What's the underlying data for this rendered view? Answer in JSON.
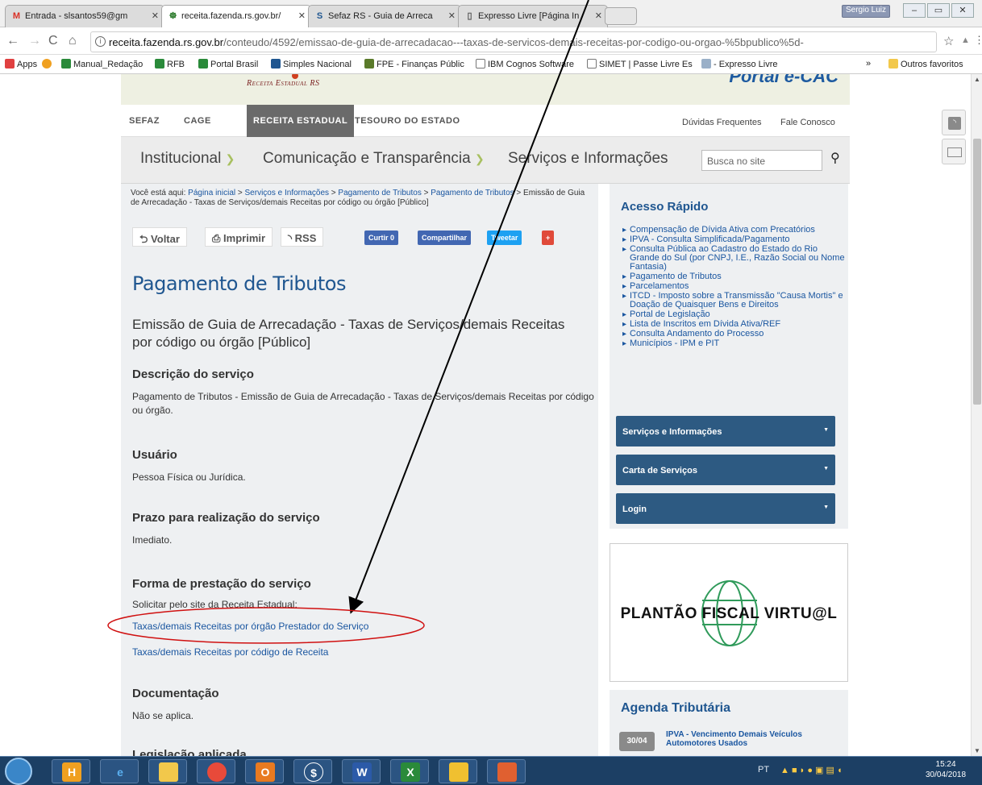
{
  "tabs": [
    {
      "label": "Entrada - slsantos59@gm",
      "icon": "M",
      "icon_color": "#d93025",
      "active": false
    },
    {
      "label": "receita.fazenda.rs.gov.br/",
      "icon": "☸",
      "icon_color": "#2a7a2a",
      "active": true
    },
    {
      "label": "Sefaz RS - Guia de Arreca",
      "icon": "S",
      "icon_color": "#1f5690",
      "active": false
    },
    {
      "label": "Expresso Livre [Página In",
      "icon": "▯",
      "icon_color": "#555555",
      "active": false
    }
  ],
  "profile_name": "Sergio Luiz",
  "address": {
    "host": "receita.fazenda.rs.gov.br",
    "path": "/conteudo/4592/emissao-de-guia-de-arrecadacao---taxas-de-servicos-demais-receitas-por-codigo-ou-orgao-%5bpublico%5d-"
  },
  "bookmarks": [
    {
      "label": "Apps",
      "color": "#e04040"
    },
    {
      "label": "",
      "color": "#f0a020"
    },
    {
      "label": "Manual_Redação",
      "color": "#2a8a3a"
    },
    {
      "label": "RFB",
      "color": "#2a8a3a"
    },
    {
      "label": "Portal Brasil",
      "color": "#2a8a3a"
    },
    {
      "label": "Simples Nacional",
      "color": "#1f5690"
    },
    {
      "label": "FPE - Finanças Públic",
      "color": "#5a7a2a"
    },
    {
      "label": "IBM Cognos Software",
      "color": "#777777"
    },
    {
      "label": "SIMET | Passe Livre Es",
      "color": "#777777"
    },
    {
      "label": "- Expresso Livre",
      "color": "#9ab0c8"
    }
  ],
  "bookmarks_more": "»",
  "bookmarks_other": "Outros favoritos",
  "site": {
    "logo": "Receita Estadual RS",
    "portal": "Portal e-CAC",
    "topnav": [
      "SEFAZ",
      "CAGE",
      "RECEITA ESTADUAL",
      "TESOURO DO ESTADO"
    ],
    "topnav_right": [
      "Dúvidas Frequentes",
      "Fale Conosco"
    ],
    "mainnav": [
      "Institucional",
      "Comunicação e Transparência",
      "Serviços e Informações"
    ],
    "search_placeholder": "Busca no site"
  },
  "breadcrumb": {
    "prefix": "Você está aqui:",
    "items": [
      "Página inicial",
      "Serviços e Informações",
      "Pagamento de Tributos",
      "Pagamento de Tributos"
    ],
    "current": "Emissão de Guia de Arrecadação - Taxas de Serviços/demais Receitas por código ou órgão [Público]"
  },
  "toolbar": {
    "back": "Voltar",
    "print": "Imprimir",
    "rss": "RSS",
    "like": "Curtir 0",
    "share": "Compartilhar",
    "tweet": "Tweetar",
    "plus": "+"
  },
  "article": {
    "title": "Pagamento de Tributos",
    "subtitle": "Emissão de Guia de Arrecadação - Taxas de Serviços/demais Receitas por código ou órgão [Público]",
    "sections": [
      {
        "heading": "Descrição do serviço",
        "text": "Pagamento de Tributos - Emissão de Guia de Arrecadação - Taxas de Serviços/demais Receitas por código ou órgão."
      },
      {
        "heading": "Usuário",
        "text": "Pessoa Física ou Jurídica."
      },
      {
        "heading": "Prazo para realização do serviço",
        "text": "Imediato."
      },
      {
        "heading": "Forma de prestação do serviço",
        "text": "Solicitar pelo site da Receita Estadual:"
      },
      {
        "heading": "Documentação",
        "text": "Não se aplica."
      }
    ],
    "links": [
      "Taxas/demais Receitas por órgão Prestador do Serviço",
      "Taxas/demais Receitas por código de Receita"
    ],
    "cut_heading": "Legislação aplicada"
  },
  "sidebar": {
    "title": "Acesso Rápido",
    "items": [
      "Compensação de Dívida Ativa com Precatórios",
      "IPVA - Consulta Simplificada/Pagamento",
      "Consulta Pública ao Cadastro do Estado do Rio Grande do Sul (por CNPJ, I.E., Razão Social ou Nome Fantasia)",
      "Pagamento de Tributos",
      "Parcelamentos",
      "ITCD - Imposto sobre a Transmissão \"Causa Mortis\" e Doação de Quaisquer Bens e Direitos",
      "Portal de Legislação",
      "Lista de Inscritos em Dívida Ativa/REF",
      "Consulta Andamento do Processo",
      "Municípios - IPM e PIT"
    ],
    "accordions": [
      "Serviços e Informações",
      "Carta de Serviços",
      "Login"
    ],
    "banner_text": "PLANTÃO FISCAL VIRTU@L",
    "agenda_title": "Agenda Tributária",
    "agenda_date": "30/04",
    "agenda_text": "IPVA - Vencimento Demais Veículos Automotores Usados"
  },
  "taskbar": {
    "apps": [
      "H",
      "e",
      "📁",
      "●",
      "O",
      "$",
      "W",
      "X",
      "▧",
      "✉"
    ],
    "lang": "PT",
    "time": "15:24",
    "date": "30/04/2018"
  },
  "colors": {
    "brand_blue": "#1f5690",
    "link_blue": "#1a56a0",
    "accordion": "#2d5a82",
    "annotation_red": "#d01010"
  }
}
